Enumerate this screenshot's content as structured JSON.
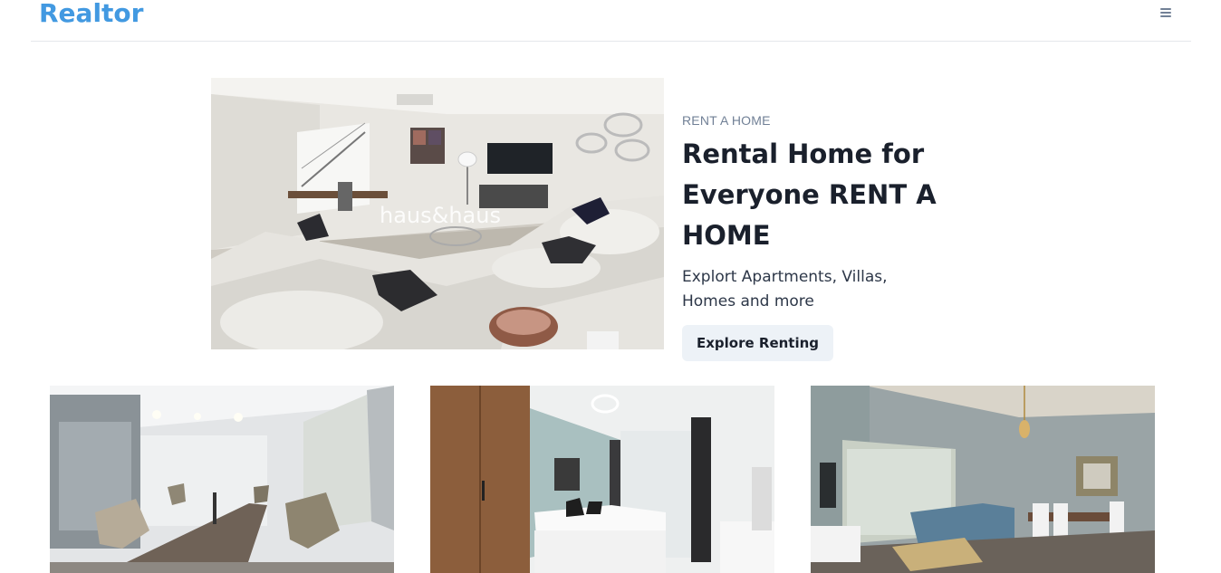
{
  "header": {
    "logo": "Realtor",
    "menu_icon": "hamburger-menu-icon"
  },
  "hero": {
    "image_alt": "Living room interior",
    "watermark": "haus&haus",
    "eyebrow": "RENT A HOME",
    "title": "Rental Home for Everyone RENT A HOME",
    "description": "Explort Apartments, Villas, Homes and more",
    "cta_label": "Explore Renting"
  },
  "listings": [
    {
      "image_alt": "Office meeting room"
    },
    {
      "image_alt": "Bedroom with wardrobe"
    },
    {
      "image_alt": "Living and dining room"
    }
  ],
  "colors": {
    "brand": "#4299e1",
    "heading": "#1a202c",
    "muted": "#718096",
    "button_bg": "#edf2f7"
  }
}
